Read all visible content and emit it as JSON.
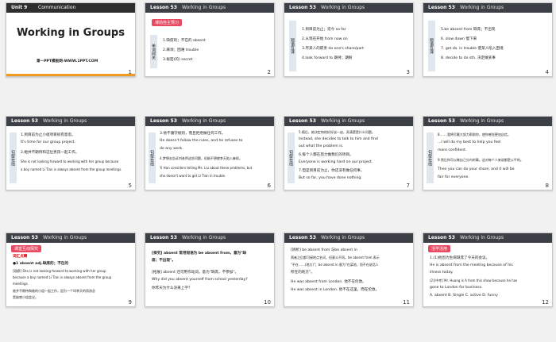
{
  "slides": [
    {
      "num": "1",
      "unit": "Unit 9",
      "unit_label": "Communication",
      "title": "Working in Groups",
      "footer": "第一PPT模板网-WWW.1PPT.COM"
    },
    {
      "num": "2",
      "lesson": "Lesson 53",
      "ttl": "Working in Groups",
      "tag": "课前自主预习",
      "side": "单词闯关",
      "lines": [
        "1.缺席的；不在的 absent",
        "2.麻烦；困难 trouble",
        "3.秘密(的) secret"
      ]
    },
    {
      "num": "3",
      "lesson": "Lesson 53",
      "ttl": "Working in Groups",
      "side": "短语互译",
      "lines": [
        "1.到目前为止；迄今 so far",
        "2.从现在开始 from now on",
        "3.尽某人的职责 do one's share/part",
        "4.look forward to 期待；期盼"
      ]
    },
    {
      "num": "4",
      "lesson": "Lesson 53",
      "ttl": "Working in Groups",
      "side": "短语互译",
      "lines": [
        "5.be absent from 缺席；不出现",
        "6. slow down 慢下来",
        "7. get sb. in trouble 使某人陷入困境",
        "8. decide to do sth. 决定做某事"
      ]
    },
    {
      "num": "5",
      "lesson": "Lesson 53",
      "ttl": "Working in Groups",
      "side": "句型在线",
      "lines": [
        "1.到目前为止小组项目很有意思。",
        "It's time for our group project.",
        "2.她并不期待和这位男孩一起工作。",
        "She is not looking forward to working with her group because",
        "a boy named Li Tian is always absent from the group meetings."
      ]
    },
    {
      "num": "6",
      "lesson": "Lesson 53",
      "ttl": "Working in Groups",
      "side": "句型在线",
      "lines": [
        "3.他不遵守规则，而且拒绝做任何工作。",
        "He doesn't follow the rules, and he refuses to",
        "do any work.",
        "4.梦想去告诉刘老师这些问题，但她不想使李天陷入麻烦。",
        "Yi Han considers telling Ms. Liu about these problems, but",
        "she doesn't want to get Li Tian in trouble."
      ]
    },
    {
      "num": "7",
      "lesson": "Lesson 53",
      "ttl": "Working in Groups",
      "side": "句型在线",
      "lines": [
        "5.随后，她决定和他好好谈一谈，弄清楚是什么问题。",
        "Instead, she decides to talk to him and find",
        "out what the problem is.",
        "6.每个人都在努力做我们的项目。",
        "Everyone is working hard on our project.",
        "7.但是到目前为止，你还没有做任何事。",
        "But so far, you have done nothing."
      ]
    },
    {
      "num": "8",
      "lesson": "Lesson 53",
      "ttl": "Working in Groups",
      "side": "句型在线",
      "lines": [
        "8.……我将尽最大努力帮助你，使你感觉更加自信。",
        "...I will do my best to help you feel",
        "more confident.",
        "9.然后你可以做自己分内的事。这对每个人来说都是公平的。",
        "Then you can do your share, and it will be",
        "fair for everyone."
      ]
    },
    {
      "num": "9",
      "lesson": "Lesson 53",
      "ttl": "Working in Groups",
      "tag": "课堂互动探究",
      "sub": "词汇点睛",
      "lines": [
        "●1 absent adj.缺席的；不在的",
        "[观察] She is not looking forward to working with her group",
        "because a boy named Li Tian is always absent from the group",
        "meetings.",
        "她并不期待和她的小组一起工作，因为一个叫李天的男孩总",
        "是缺席小组会议。"
      ]
    },
    {
      "num": "10",
      "lesson": "Lesson 53",
      "ttl": "Working in Groups",
      "lines": [
        "[探究] absent 常用短语为 be absent from，意为\"缺",
        "席；不出现\"。",
        "[拓展] absent 还可用作动词，意为\"缺席，不参加\"。",
        "Why did you absent yourself from school yesterday?",
        "你昨天为什么没来上学？"
      ]
    },
    {
      "num": "11",
      "lesson": "Lesson 53",
      "ttl": "Working in Groups",
      "lines": [
        "[辨析] be absent from 与be absent in",
        "两者之后都可接地点名词，但意义不同。be absent from 表示",
        "\"不在……(地方)\"；be absent in 意为\"在某地，而不在说话人",
        "所在的地方\"。",
        "He was absent from London. 他不在伦敦。",
        "He was absent in London. 他不在这里，而在伦敦。"
      ]
    },
    {
      "num": "12",
      "lesson": "Lesson 53",
      "ttl": "Working in Groups",
      "tag": "活学活用",
      "lines": [
        "1.(1)他因为生病缺席了今天的会议。",
        "He is absent from the meeting because of his",
        "illness today.",
        "(2)[中考] Mr. Huang is A from this show because he has",
        "gone to London for business.",
        "A. absent  B. Single  C. active D. funny"
      ]
    }
  ],
  "colors": {
    "header_bg": "#3c3f45",
    "answer_red": "#d40000",
    "tag_pink": "#e94a63",
    "accent_orange": "#f29a1f"
  }
}
